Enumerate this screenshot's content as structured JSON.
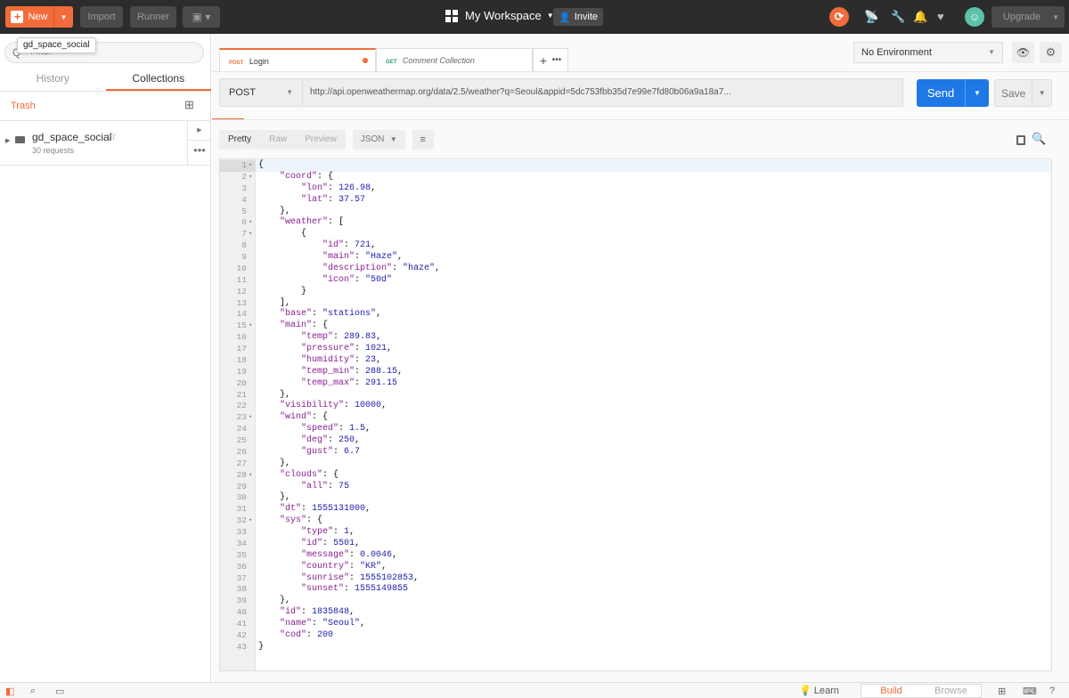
{
  "topbar": {
    "new_label": "New",
    "import_label": "Import",
    "runner_label": "Runner",
    "workspace_label": "My Workspace",
    "invite_label": "Invite",
    "upgrade_label": "Upgrade",
    "accent": "#f26b3a"
  },
  "tooltip": "gd_space_social",
  "sidebar": {
    "search_placeholder": "Filter",
    "tabs": [
      "History",
      "Collections"
    ],
    "trash_label": "Trash",
    "collection": {
      "name": "gd_space_social",
      "count": "30 requests"
    }
  },
  "tabs": [
    {
      "method": "POST",
      "label": "Login"
    },
    {
      "method": "GET",
      "label": "Comment Collection"
    }
  ],
  "environment": {
    "selected": "No Environment"
  },
  "request": {
    "method": "POST",
    "url": "http://api.openweathermap.org/data/2.5/weather?q=Seoul&appid=5dc753fbb35d7e99e7fd80b06a9a18a7...",
    "send_label": "Send",
    "save_label": "Save"
  },
  "response": {
    "views": [
      "Pretty",
      "Raw",
      "Preview"
    ],
    "format": "JSON",
    "lines": [
      "{",
      "    \"coord\": {",
      "        \"lon\": 126.98,",
      "        \"lat\": 37.57",
      "    },",
      "    \"weather\": [",
      "        {",
      "            \"id\": 721,",
      "            \"main\": \"Haze\",",
      "            \"description\": \"haze\",",
      "            \"icon\": \"50d\"",
      "        }",
      "    ],",
      "    \"base\": \"stations\",",
      "    \"main\": {",
      "        \"temp\": 289.83,",
      "        \"pressure\": 1021,",
      "        \"humidity\": 23,",
      "        \"temp_min\": 288.15,",
      "        \"temp_max\": 291.15",
      "    },",
      "    \"visibility\": 10000,",
      "    \"wind\": {",
      "        \"speed\": 1.5,",
      "        \"deg\": 250,",
      "        \"gust\": 6.7",
      "    },",
      "    \"clouds\": {",
      "        \"all\": 75",
      "    },",
      "    \"dt\": 1555131000,",
      "    \"sys\": {",
      "        \"type\": 1,",
      "        \"id\": 5501,",
      "        \"message\": 0.0046,",
      "        \"country\": \"KR\",",
      "        \"sunrise\": 1555102853,",
      "        \"sunset\": 1555149855",
      "    },",
      "    \"id\": 1835848,",
      "    \"name\": \"Seoul\",",
      "    \"cod\": 200",
      "}"
    ],
    "fold_lines": [
      1,
      2,
      6,
      7,
      15,
      23,
      28,
      32
    ]
  },
  "statusbar": {
    "learn_label": "Learn",
    "build_label": "Build",
    "browse_label": "Browse"
  }
}
